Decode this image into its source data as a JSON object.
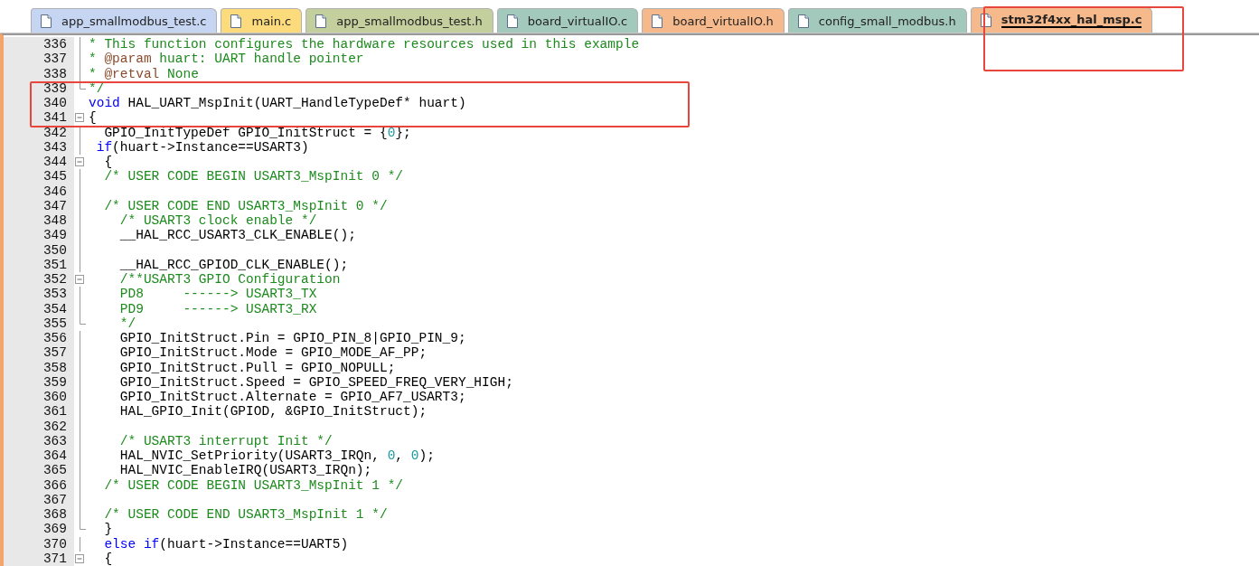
{
  "tabs": [
    {
      "label": "app_smallmodbus_test.c",
      "selected": false,
      "color": "#c6d6f2"
    },
    {
      "label": "main.c",
      "selected": false,
      "color": "#fbdb7c"
    },
    {
      "label": "app_smallmodbus_test.h",
      "selected": false,
      "color": "#c3cf9d"
    },
    {
      "label": "board_virtualIO.c",
      "selected": false,
      "color": "#a3c9bd"
    },
    {
      "label": "board_virtualIO.h",
      "selected": false,
      "color": "#f6b98b"
    },
    {
      "label": "config_small_modbus.h",
      "selected": false,
      "color": "#a3c9bd"
    },
    {
      "label": "stm32f4xx_hal_msp.c",
      "selected": true,
      "color": "#f6b98b"
    }
  ],
  "editor": {
    "lines": [
      {
        "number": "336",
        "kind": "in_fold",
        "segments": [
          {
            "kind": "comment",
            "text": "* This function configures the hardware resources used in this example"
          }
        ]
      },
      {
        "number": "337",
        "kind": "in_fold",
        "segments": [
          {
            "kind": "comment",
            "text": "* "
          },
          {
            "kind": "doctag",
            "text": "@param"
          },
          {
            "kind": "comment",
            "text": " huart: UART handle pointer"
          }
        ]
      },
      {
        "number": "338",
        "kind": "in_fold",
        "segments": [
          {
            "kind": "comment",
            "text": "* "
          },
          {
            "kind": "doctag",
            "text": "@retval"
          },
          {
            "kind": "comment",
            "text": " None"
          }
        ]
      },
      {
        "number": "339",
        "kind": "fold_end",
        "segments": [
          {
            "kind": "comment",
            "text": "*/"
          }
        ]
      },
      {
        "number": "340",
        "kind": "plain",
        "segments": [
          {
            "kind": "keyword",
            "text": "void"
          },
          {
            "kind": "plain",
            "text": " HAL_UART_MspInit(UART_HandleTypeDef* huart)"
          }
        ]
      },
      {
        "number": "341",
        "kind": "fold_start",
        "segments": [
          {
            "kind": "plain",
            "text": "{"
          }
        ]
      },
      {
        "number": "342",
        "kind": "in_fold",
        "segments": [
          {
            "kind": "plain",
            "text": "  GPIO_InitTypeDef GPIO_InitStruct = {"
          },
          {
            "kind": "number",
            "text": "0"
          },
          {
            "kind": "plain",
            "text": "};"
          }
        ]
      },
      {
        "number": "343",
        "kind": "in_fold",
        "segments": [
          {
            "kind": "keyword",
            "text": " if"
          },
          {
            "kind": "plain",
            "text": "(huart->Instance==USART3)"
          }
        ]
      },
      {
        "number": "344",
        "kind": "fold_start",
        "segments": [
          {
            "kind": "plain",
            "text": "  {"
          }
        ]
      },
      {
        "number": "345",
        "kind": "in_fold",
        "segments": [
          {
            "kind": "comment",
            "text": "  /* USER CODE BEGIN USART3_MspInit 0 */"
          }
        ]
      },
      {
        "number": "346",
        "kind": "in_fold"
      },
      {
        "number": "347",
        "kind": "in_fold",
        "segments": [
          {
            "kind": "comment",
            "text": "  /* USER CODE END USART3_MspInit 0 */"
          }
        ]
      },
      {
        "number": "348",
        "kind": "in_fold",
        "segments": [
          {
            "kind": "comment",
            "text": "    /* USART3 clock enable */"
          }
        ]
      },
      {
        "number": "349",
        "kind": "in_fold",
        "segments": [
          {
            "kind": "plain",
            "text": "    __HAL_RCC_USART3_CLK_ENABLE();"
          }
        ]
      },
      {
        "number": "350",
        "kind": "in_fold"
      },
      {
        "number": "351",
        "kind": "in_fold",
        "segments": [
          {
            "kind": "plain",
            "text": "    __HAL_RCC_GPIOD_CLK_ENABLE();"
          }
        ]
      },
      {
        "number": "352",
        "kind": "fold_start",
        "segments": [
          {
            "kind": "comment",
            "text": "    /**USART3 GPIO Configuration"
          }
        ]
      },
      {
        "number": "353",
        "kind": "in_fold",
        "segments": [
          {
            "kind": "comment",
            "text": "    PD8     ------> USART3_TX"
          }
        ]
      },
      {
        "number": "354",
        "kind": "in_fold",
        "segments": [
          {
            "kind": "comment",
            "text": "    PD9     ------> USART3_RX"
          }
        ]
      },
      {
        "number": "355",
        "kind": "fold_end",
        "segments": [
          {
            "kind": "comment",
            "text": "    */"
          }
        ]
      },
      {
        "number": "356",
        "kind": "in_fold",
        "segments": [
          {
            "kind": "plain",
            "text": "    GPIO_InitStruct.Pin = GPIO_PIN_8|GPIO_PIN_9;"
          }
        ]
      },
      {
        "number": "357",
        "kind": "in_fold",
        "segments": [
          {
            "kind": "plain",
            "text": "    GPIO_InitStruct.Mode = GPIO_MODE_AF_PP;"
          }
        ]
      },
      {
        "number": "358",
        "kind": "in_fold",
        "segments": [
          {
            "kind": "plain",
            "text": "    GPIO_InitStruct.Pull = GPIO_NOPULL;"
          }
        ]
      },
      {
        "number": "359",
        "kind": "in_fold",
        "segments": [
          {
            "kind": "plain",
            "text": "    GPIO_InitStruct.Speed = GPIO_SPEED_FREQ_VERY_HIGH;"
          }
        ]
      },
      {
        "number": "360",
        "kind": "in_fold",
        "segments": [
          {
            "kind": "plain",
            "text": "    GPIO_InitStruct.Alternate = GPIO_AF7_USART3;"
          }
        ]
      },
      {
        "number": "361",
        "kind": "in_fold",
        "segments": [
          {
            "kind": "plain",
            "text": "    HAL_GPIO_Init(GPIOD, &GPIO_InitStruct);"
          }
        ]
      },
      {
        "number": "362",
        "kind": "in_fold"
      },
      {
        "number": "363",
        "kind": "in_fold",
        "segments": [
          {
            "kind": "comment",
            "text": "    /* USART3 interrupt Init */"
          }
        ]
      },
      {
        "number": "364",
        "kind": "in_fold",
        "segments": [
          {
            "kind": "plain",
            "text": "    HAL_NVIC_SetPriority(USART3_IRQn, "
          },
          {
            "kind": "number",
            "text": "0"
          },
          {
            "kind": "plain",
            "text": ", "
          },
          {
            "kind": "number",
            "text": "0"
          },
          {
            "kind": "plain",
            "text": ");"
          }
        ]
      },
      {
        "number": "365",
        "kind": "in_fold",
        "segments": [
          {
            "kind": "plain",
            "text": "    HAL_NVIC_EnableIRQ(USART3_IRQn);"
          }
        ]
      },
      {
        "number": "366",
        "kind": "in_fold",
        "segments": [
          {
            "kind": "comment",
            "text": "  /* USER CODE BEGIN USART3_MspInit 1 */"
          }
        ]
      },
      {
        "number": "367",
        "kind": "in_fold"
      },
      {
        "number": "368",
        "kind": "in_fold",
        "segments": [
          {
            "kind": "comment",
            "text": "  /* USER CODE END USART3_MspInit 1 */"
          }
        ]
      },
      {
        "number": "369",
        "kind": "fold_end",
        "segments": [
          {
            "kind": "plain",
            "text": "  }"
          }
        ]
      },
      {
        "number": "370",
        "kind": "in_fold",
        "segments": [
          {
            "kind": "keyword",
            "text": "  else if"
          },
          {
            "kind": "plain",
            "text": "(huart->Instance==UART5)"
          }
        ]
      },
      {
        "number": "371",
        "kind": "fold_start",
        "segments": [
          {
            "kind": "plain",
            "text": "  {"
          }
        ]
      }
    ]
  }
}
